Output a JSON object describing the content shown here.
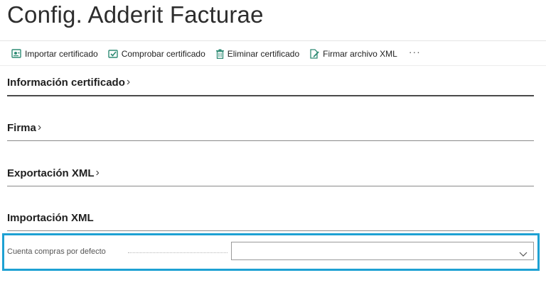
{
  "page": {
    "title": "Config. Adderit Facturae"
  },
  "actions": [
    {
      "label": "Importar certificado",
      "icon": "import-certificate-icon"
    },
    {
      "label": "Comprobar certificado",
      "icon": "check-certificate-icon"
    },
    {
      "label": "Eliminar certificado",
      "icon": "trash-icon"
    },
    {
      "label": "Firmar archivo XML",
      "icon": "sign-file-icon"
    }
  ],
  "more_label": "···",
  "sections": [
    {
      "title": "Información certificado",
      "chevron": "›"
    },
    {
      "title": "Firma",
      "chevron": "›"
    },
    {
      "title": "Exportación XML",
      "chevron": "›"
    },
    {
      "title": "Importación XML"
    }
  ],
  "field": {
    "label": "Cuenta compras por defecto",
    "value": ""
  },
  "colors": {
    "icon_teal": "#2e8b74",
    "highlight": "#1ea1d3"
  }
}
